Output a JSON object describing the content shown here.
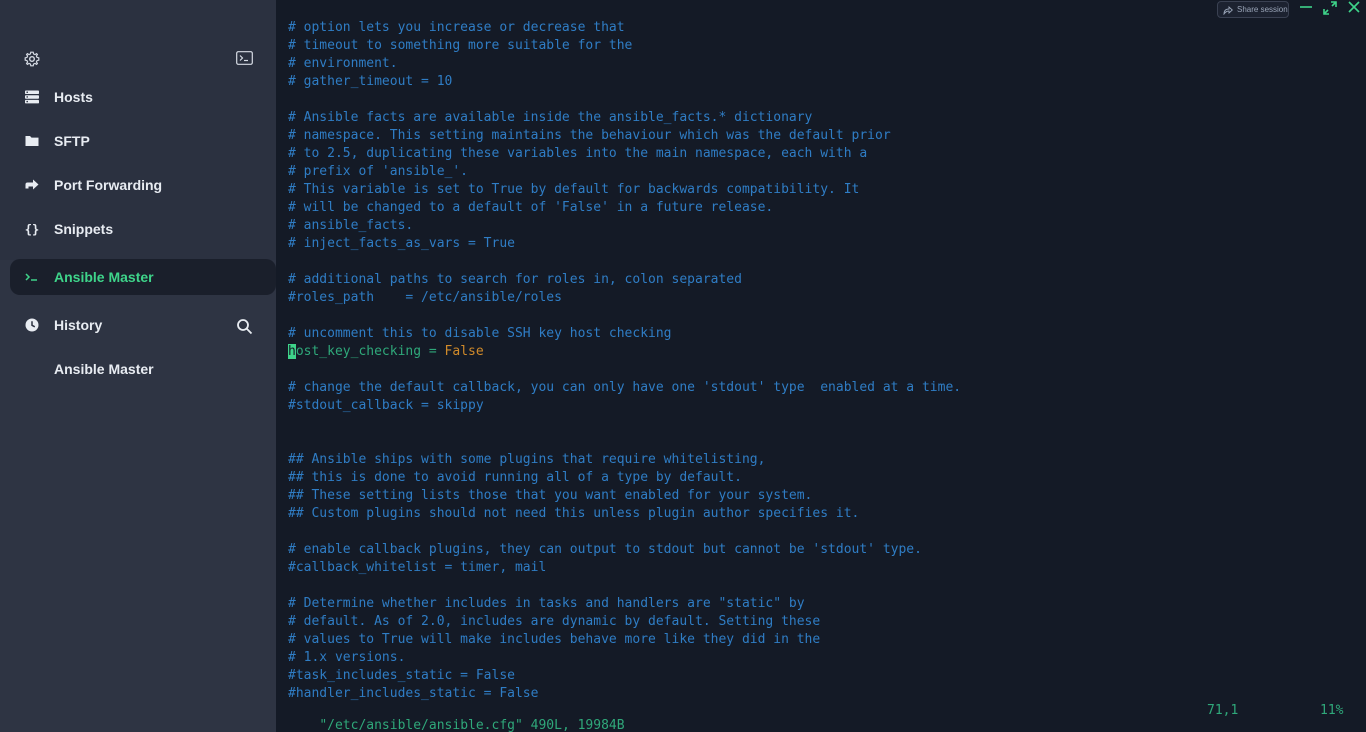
{
  "sidebar": {
    "items": [
      {
        "label": "Hosts",
        "icon": "hosts-icon"
      },
      {
        "label": "SFTP",
        "icon": "folder-icon"
      },
      {
        "label": "Port Forwarding",
        "icon": "port-forward-icon"
      },
      {
        "label": "Snippets",
        "icon": "braces-icon"
      },
      {
        "label": "Ansible Master",
        "icon": "terminal-prompt-icon",
        "active": true
      },
      {
        "label": "History",
        "icon": "clock-icon"
      },
      {
        "label": "Ansible Master"
      }
    ]
  },
  "toolbar": {
    "share_label": "Share session"
  },
  "terminal": {
    "lines": [
      {
        "t": "# option lets you increase or decrease that",
        "c": "cmt"
      },
      {
        "t": "# timeout to something more suitable for the",
        "c": "cmt"
      },
      {
        "t": "# environment.",
        "c": "cmt"
      },
      {
        "t": "# gather_timeout = 10",
        "c": "cmt"
      },
      {
        "t": "",
        "c": "cmt"
      },
      {
        "t": "# Ansible facts are available inside the ansible_facts.* dictionary",
        "c": "cmt"
      },
      {
        "t": "# namespace. This setting maintains the behaviour which was the default prior",
        "c": "cmt"
      },
      {
        "t": "# to 2.5, duplicating these variables into the main namespace, each with a",
        "c": "cmt"
      },
      {
        "t": "# prefix of 'ansible_'.",
        "c": "cmt"
      },
      {
        "t": "# This variable is set to True by default for backwards compatibility. It",
        "c": "cmt"
      },
      {
        "t": "# will be changed to a default of 'False' in a future release.",
        "c": "cmt"
      },
      {
        "t": "# ansible_facts.",
        "c": "cmt"
      },
      {
        "t": "# inject_facts_as_vars = True",
        "c": "cmt"
      },
      {
        "t": "",
        "c": "cmt"
      },
      {
        "t": "# additional paths to search for roles in, colon separated",
        "c": "cmt"
      },
      {
        "t": "#roles_path    = /etc/ansible/roles",
        "c": "cmt"
      },
      {
        "t": "",
        "c": "cmt"
      },
      {
        "t": "# uncomment this to disable SSH key host checking",
        "c": "cmt"
      },
      {
        "t": "host_key_checking = False",
        "c": "cfg",
        "special": "active"
      },
      {
        "t": "",
        "c": "cmt"
      },
      {
        "t": "# change the default callback, you can only have one 'stdout' type  enabled at a time.",
        "c": "cmt"
      },
      {
        "t": "#stdout_callback = skippy",
        "c": "cmt"
      },
      {
        "t": "",
        "c": "cmt"
      },
      {
        "t": "",
        "c": "cmt"
      },
      {
        "t": "## Ansible ships with some plugins that require whitelisting,",
        "c": "cmt"
      },
      {
        "t": "## this is done to avoid running all of a type by default.",
        "c": "cmt"
      },
      {
        "t": "## These setting lists those that you want enabled for your system.",
        "c": "cmt"
      },
      {
        "t": "## Custom plugins should not need this unless plugin author specifies it.",
        "c": "cmt"
      },
      {
        "t": "",
        "c": "cmt"
      },
      {
        "t": "# enable callback plugins, they can output to stdout but cannot be 'stdout' type.",
        "c": "cmt"
      },
      {
        "t": "#callback_whitelist = timer, mail",
        "c": "cmt"
      },
      {
        "t": "",
        "c": "cmt"
      },
      {
        "t": "# Determine whether includes in tasks and handlers are \"static\" by",
        "c": "cmt"
      },
      {
        "t": "# default. As of 2.0, includes are dynamic by default. Setting these",
        "c": "cmt"
      },
      {
        "t": "# values to True will make includes behave more like they did in the",
        "c": "cmt"
      },
      {
        "t": "# 1.x versions.",
        "c": "cmt"
      },
      {
        "t": "#task_includes_static = False",
        "c": "cmt"
      },
      {
        "t": "#handler_includes_static = False",
        "c": "cmt"
      }
    ],
    "active_line": {
      "cursor_char": "h",
      "rest": "ost_key_checking = ",
      "value": "False"
    },
    "status": {
      "file": "\"/etc/ansible/ansible.cfg\" 490L, 19984B",
      "position": "71,1",
      "percent": "11%"
    }
  },
  "colors": {
    "accent": "#3ed48a",
    "comment": "#2f7dc5",
    "config": "#2fa87a",
    "bool_value": "#d08a2a",
    "sidebar_bg": "#2b3140",
    "terminal_bg": "#141a26"
  }
}
